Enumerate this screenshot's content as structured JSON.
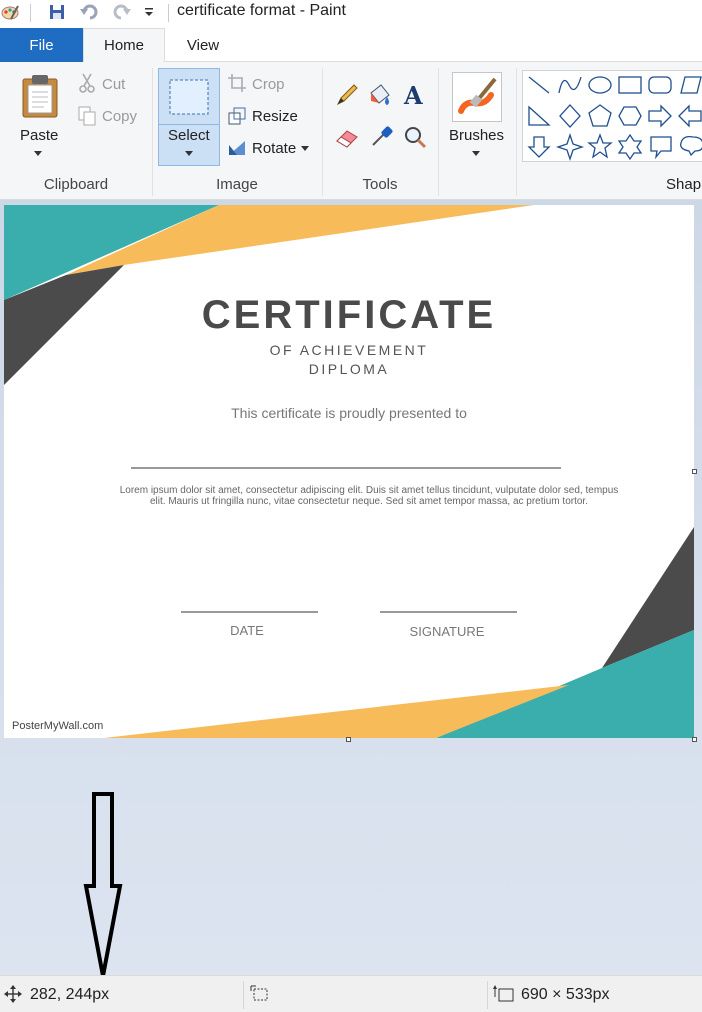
{
  "window": {
    "title": "certificate format - Paint"
  },
  "tabs": {
    "file": "File",
    "home": "Home",
    "view": "View"
  },
  "clipboard": {
    "paste": "Paste",
    "cut": "Cut",
    "copy": "Copy",
    "label": "Clipboard"
  },
  "image": {
    "select": "Select",
    "crop": "Crop",
    "resize": "Resize",
    "rotate": "Rotate",
    "label": "Image"
  },
  "tools": {
    "label": "Tools"
  },
  "brushes": {
    "label": "Brushes"
  },
  "shapes": {
    "label": "Shap"
  },
  "certificate": {
    "title": "CERTIFICATE",
    "subtitle1": "OF ACHIEVEMENT",
    "subtitle2": "DIPLOMA",
    "presented": "This certificate is proudly presented to",
    "body": "Lorem ipsum dolor sit amet, consectetur adipiscing elit. Duis sit amet tellus tincidunt, vulputate dolor sed, tempus elit. Mauris ut fringilla nunc, vitae consectetur neque. Sed sit amet tempor massa, ac pretium tortor.",
    "date_label": "DATE",
    "signature_label": "SIGNATURE",
    "watermark": "PosterMyWall.com"
  },
  "status": {
    "cursor_position": "282, 244px",
    "selection_size": "",
    "image_size": "690 × 533px"
  },
  "colors": {
    "teal": "#3aaeac",
    "orange": "#f8bb5a",
    "charcoal": "#4b4b4b",
    "file_tab": "#1e6dc2"
  }
}
